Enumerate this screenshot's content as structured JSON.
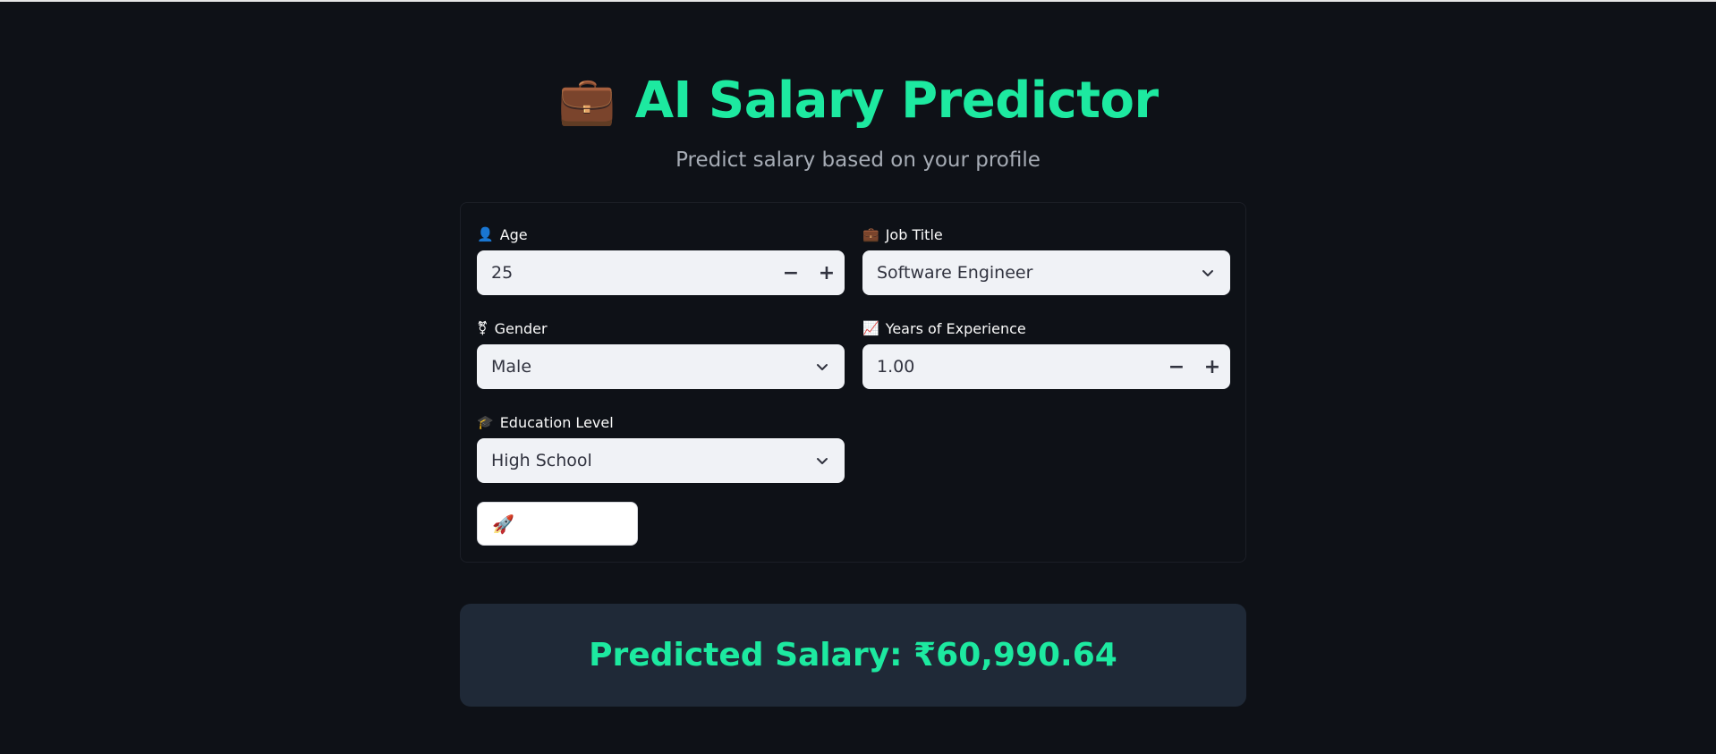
{
  "app": {
    "title": "AI Salary Predictor",
    "title_icon": "💼",
    "subtitle": "Predict salary based on your profile"
  },
  "form": {
    "age": {
      "label": "Age",
      "icon": "👤",
      "value": "25"
    },
    "job_title": {
      "label": "Job Title",
      "icon": "💼",
      "value": "Software Engineer"
    },
    "gender": {
      "label": "Gender",
      "icon": "⚧",
      "value": "Male"
    },
    "experience": {
      "label": "Years of Experience",
      "icon": "📈",
      "value": "1.00"
    },
    "education": {
      "label": "Education Level",
      "icon": "🎓",
      "value": "High School"
    },
    "predict_button": {
      "icon": "🚀",
      "label": ""
    },
    "stepper": {
      "minus": "−",
      "plus": "+"
    }
  },
  "result": {
    "text": "Predicted Salary: ₹60,990.64"
  },
  "colors": {
    "background": "#0e1117",
    "accent": "#1de9a0",
    "input_bg": "#f0f2f6",
    "result_bg": "#1f2937"
  }
}
